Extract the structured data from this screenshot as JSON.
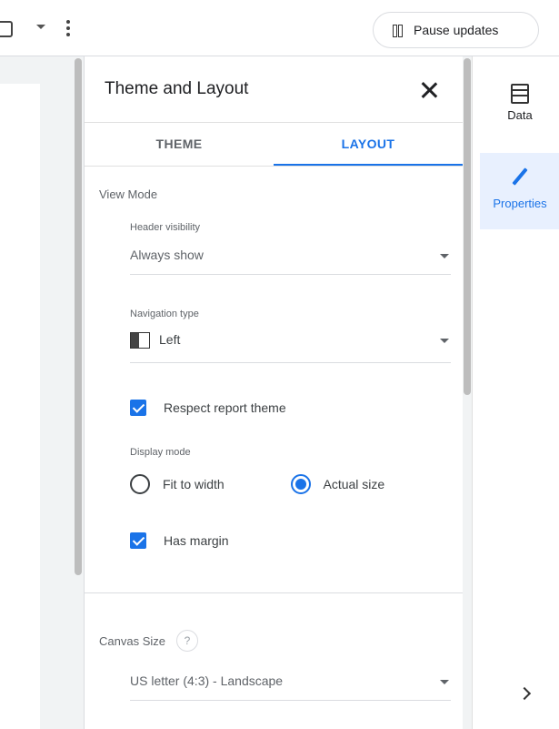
{
  "toolbar": {
    "pause_label": "Pause updates"
  },
  "panel": {
    "title": "Theme and Layout",
    "tabs": [
      {
        "label": "THEME",
        "active": false
      },
      {
        "label": "LAYOUT",
        "active": true
      }
    ],
    "view_mode": {
      "label": "View Mode",
      "header_visibility": {
        "label": "Header visibility",
        "value": "Always show"
      },
      "navigation_type": {
        "label": "Navigation type",
        "value": "Left"
      },
      "respect_theme": {
        "label": "Respect report theme",
        "checked": true
      },
      "display_mode": {
        "label": "Display mode",
        "options": [
          {
            "label": "Fit to width",
            "selected": false
          },
          {
            "label": "Actual size",
            "selected": true
          }
        ]
      },
      "has_margin": {
        "label": "Has margin",
        "checked": true
      }
    },
    "canvas_size": {
      "label": "Canvas Size",
      "help": "?",
      "value": "US letter (4:3) - Landscape"
    }
  },
  "rail": {
    "items": [
      {
        "label": "Data",
        "icon": "database-icon",
        "active": false
      },
      {
        "label": "Properties",
        "icon": "pencil-icon",
        "active": true
      }
    ]
  },
  "colors": {
    "accent": "#1a73e8",
    "active_bg": "#e8f0fe"
  }
}
